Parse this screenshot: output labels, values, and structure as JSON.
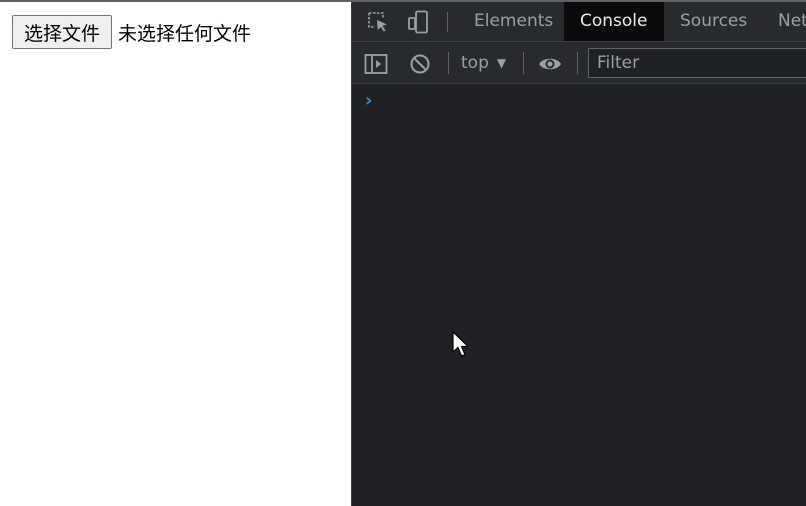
{
  "page": {
    "file_button_label": "选择文件",
    "file_status": "未选择任何文件"
  },
  "devtools": {
    "tabs": [
      {
        "label": "Elements",
        "active": false
      },
      {
        "label": "Console",
        "active": true
      },
      {
        "label": "Sources",
        "active": false
      },
      {
        "label": "Net",
        "active": false
      }
    ],
    "toolbar": {
      "context": "top",
      "filter_placeholder": "Filter"
    },
    "console": {
      "prompt": "›"
    }
  },
  "colors": {
    "devtools_bg": "#202124",
    "active_tab_bg": "#0b0b0b",
    "prompt_blue": "#3b8fd4"
  }
}
